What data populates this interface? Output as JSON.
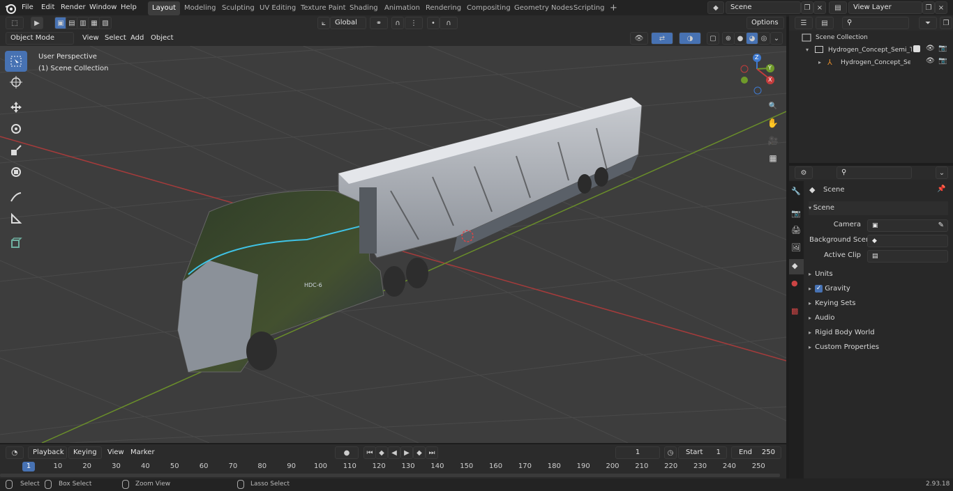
{
  "menu": {
    "file": "File",
    "edit": "Edit",
    "render": "Render",
    "window": "Window",
    "help": "Help"
  },
  "workspaces": [
    "Layout",
    "Modeling",
    "Sculpting",
    "UV Editing",
    "Texture Paint",
    "Shading",
    "Animation",
    "Rendering",
    "Compositing",
    "Geometry Nodes",
    "Scripting"
  ],
  "scene_field": "Scene",
  "view_layer_field": "View Layer",
  "viewport": {
    "mode": "Object Mode",
    "menu_view": "View",
    "menu_select": "Select",
    "menu_add": "Add",
    "menu_object": "Object",
    "orientation": "Global",
    "options": "Options",
    "perspective_label": "User Perspective",
    "collection_label": "(1) Scene Collection",
    "model_text": "HDC-6",
    "gizmo": {
      "z": "Z",
      "y": "Y",
      "x": "X"
    }
  },
  "outliner": {
    "root": "Scene Collection",
    "item1": "Hydrogen_Concept_Semi_Tru",
    "item2": "Hydrogen_Concept_Sem"
  },
  "properties": {
    "context": "Scene",
    "panel": "Scene",
    "camera_label": "Camera",
    "background_scene_label": "Background Scene",
    "active_clip_label": "Active Clip",
    "sections": [
      "Units",
      "Gravity",
      "Keying Sets",
      "Audio",
      "Rigid Body World",
      "Custom Properties"
    ],
    "gravity_checked": true
  },
  "timeline": {
    "playback": "Playback",
    "keying": "Keying",
    "view": "View",
    "marker": "Marker",
    "current_frame": "1",
    "start_label": "Start",
    "start_value": "1",
    "end_label": "End",
    "end_value": "250",
    "ruler_current": "1",
    "ticks": [
      "10",
      "20",
      "30",
      "40",
      "50",
      "60",
      "70",
      "80",
      "90",
      "100",
      "110",
      "120",
      "130",
      "140",
      "150",
      "160",
      "170",
      "180",
      "190",
      "200",
      "210",
      "220",
      "230",
      "240",
      "250"
    ]
  },
  "status": {
    "select": "Select",
    "box_select": "Box Select",
    "zoom_view": "Zoom View",
    "lasso_select": "Lasso Select",
    "version": "2.93.18"
  },
  "colors": {
    "accent": "#4772b3",
    "x_axis": "#c43c3c",
    "y_axis": "#6f9a2a",
    "z_axis": "#3f7ad0"
  }
}
